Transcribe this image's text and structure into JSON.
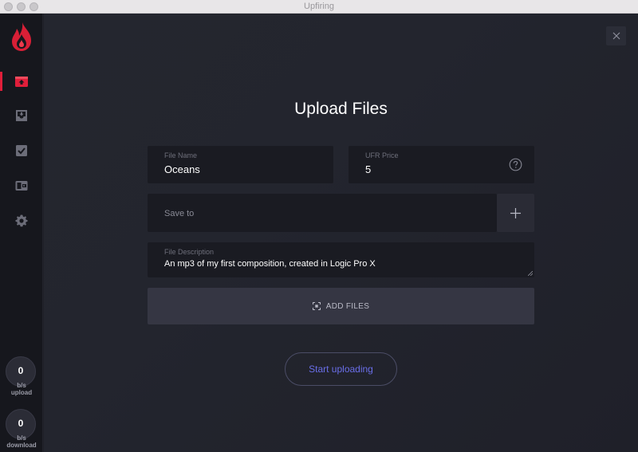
{
  "window": {
    "title": "Upfiring"
  },
  "sidebar": {
    "nav": [
      {
        "icon": "upload-icon",
        "active": true
      },
      {
        "icon": "download-icon",
        "active": false
      },
      {
        "icon": "checkbox-icon",
        "active": false
      },
      {
        "icon": "wallet-icon",
        "active": false
      },
      {
        "icon": "gear-icon",
        "active": false
      }
    ],
    "upload_meter": {
      "value": "0",
      "unit": "b/s",
      "label": "upload"
    },
    "download_meter": {
      "value": "0",
      "unit": "b/s",
      "label": "download"
    }
  },
  "main": {
    "title": "Upload Files",
    "file_name": {
      "label": "File Name",
      "value": "Oceans"
    },
    "ufr_price": {
      "label": "UFR Price",
      "value": "5"
    },
    "save_to": {
      "placeholder": "Save to"
    },
    "file_description": {
      "label": "File Description",
      "value": "An mp3 of my first composition, created in Logic Pro X"
    },
    "add_files_label": "ADD FILES",
    "start_button_label": "Start uploading"
  },
  "colors": {
    "accent_red": "#e01e3a",
    "button_text": "#6a6ee8",
    "background": "#23252e"
  }
}
